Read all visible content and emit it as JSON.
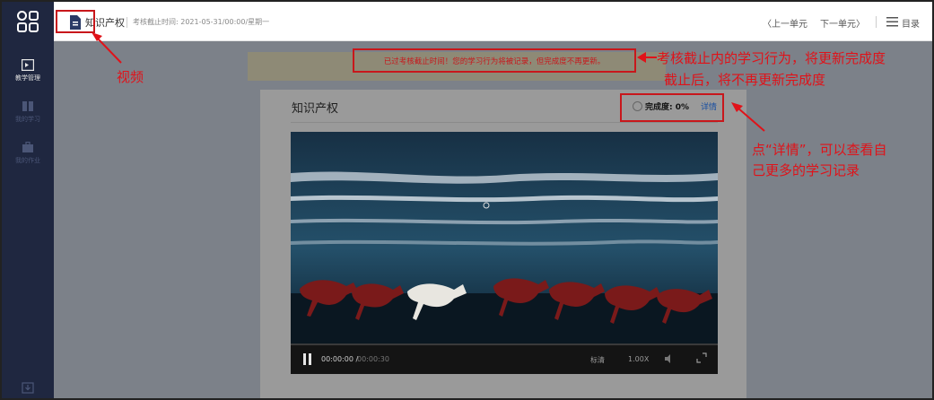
{
  "colors": {
    "sidebar_bg": "#1f2740",
    "overlay_grey": "#7c8189",
    "annotation_red": "#e01219",
    "detail_link": "#1a4fa0"
  },
  "header": {
    "logo_icon": "grid-logo-icon",
    "doc_icon": "document-icon",
    "course_title": "知识产权",
    "deadline": "考核截止时间: 2021-05-31/00:00/星期一",
    "prev_unit": "〈上一单元",
    "next_unit": "下一单元〉",
    "menu_icon": "list-icon",
    "menu_label": "目录"
  },
  "sidebar": {
    "items": [
      {
        "icon": "teaching-management-icon",
        "label": "教学管理"
      },
      {
        "icon": "book-icon",
        "label": "我的学习"
      },
      {
        "icon": "briefcase-icon",
        "label": "我的作业"
      },
      {
        "icon": "download-icon",
        "label": ""
      }
    ]
  },
  "notice": {
    "text": "已过考核截止时间！您的学习行为将被记录，但完成度不再更新。"
  },
  "panel": {
    "title": "知识产权",
    "progress_label": "完成度: 0%",
    "detail_link": "详情"
  },
  "video": {
    "time_current": "00:00:00 / ",
    "time_total": "00:00:30",
    "quality": "标清",
    "speed": "1.00X",
    "progress_fraction": 0
  },
  "annotations": {
    "video_label": "视频",
    "deadline_line_1": "考核截止内的学习行为，将更新完成度",
    "deadline_line_2": "截止后，将不再更新完成度",
    "detail_line_1": "点“详情”，可以查看自",
    "detail_line_2": "己更多的学习记录"
  }
}
